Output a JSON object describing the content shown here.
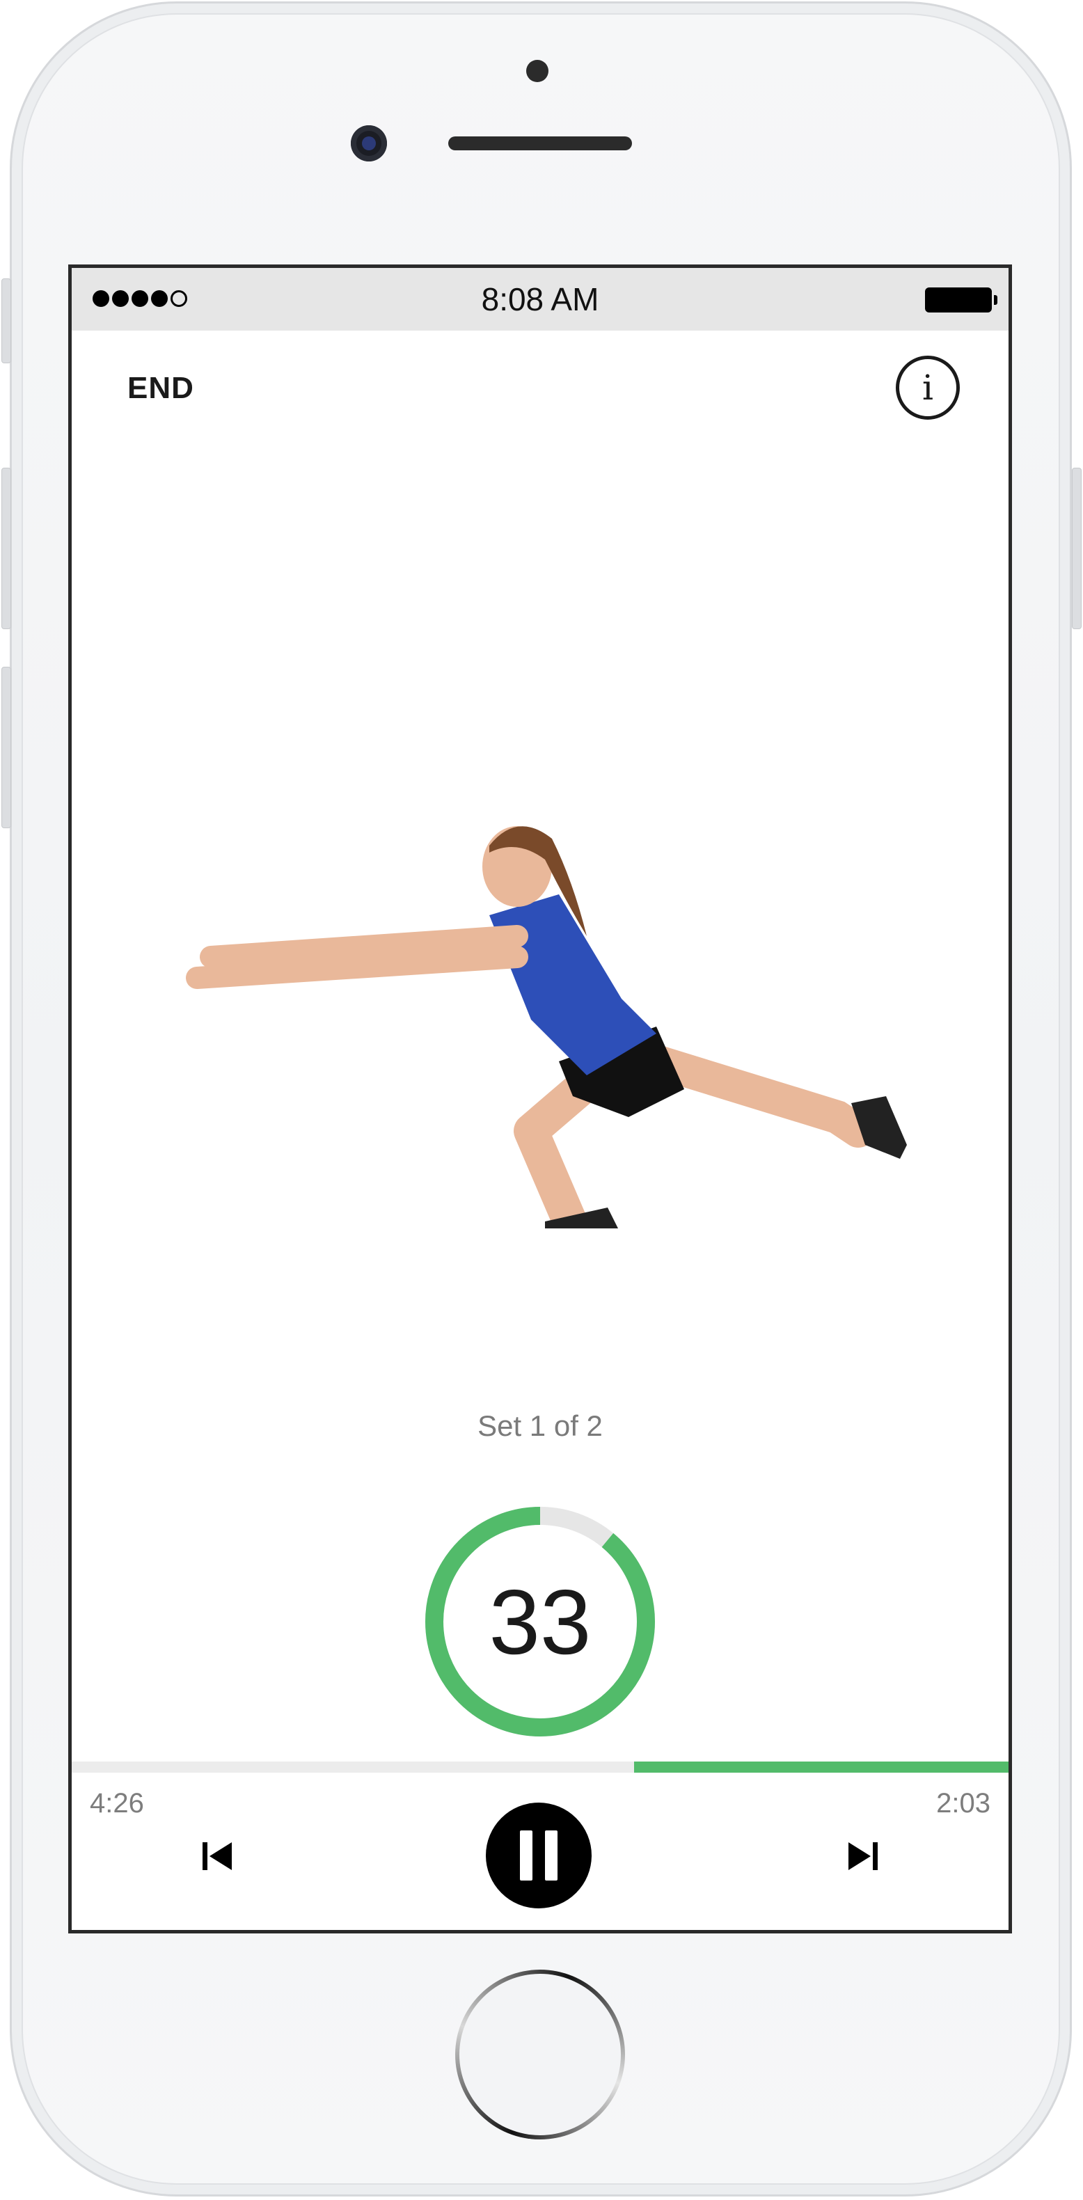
{
  "status_bar": {
    "time": "8:08 AM",
    "signal_filled": 4,
    "signal_total": 5
  },
  "header": {
    "end_label": "END",
    "info_icon": "info-circle-icon",
    "info_glyph": "i"
  },
  "exercise": {
    "image": "woman-single-leg-squat-reach"
  },
  "set": {
    "label": "Set 1 of 2"
  },
  "timer": {
    "value": "33",
    "ring_fraction_remaining": 0.89,
    "ring_color": "#52bb6a",
    "ring_track_color": "#e6e6e6"
  },
  "playback": {
    "elapsed": "4:26",
    "remaining": "2:03",
    "progress_fill_fraction": 0.4,
    "progress_color": "#52bb6a",
    "prev_icon": "skip-previous-icon",
    "pause_icon": "pause-icon",
    "next_icon": "skip-next-icon"
  }
}
